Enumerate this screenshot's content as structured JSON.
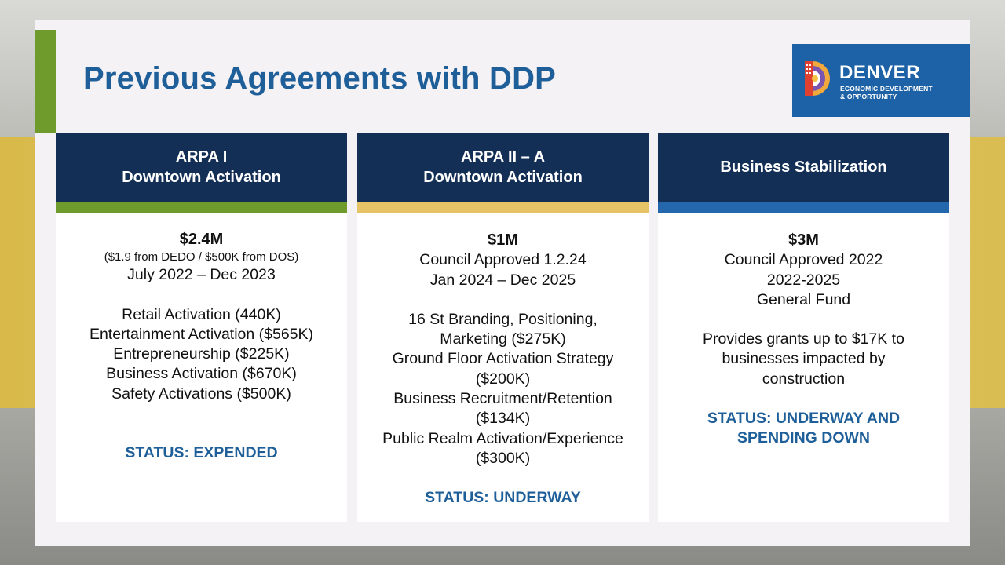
{
  "slide": {
    "title": "Previous Agreements with DDP",
    "logo": {
      "name": "DENVER",
      "sub_line1": "ECONOMIC DEVELOPMENT",
      "sub_line2": "& OPPORTUNITY"
    }
  },
  "colors": {
    "title_blue": "#1f5f99",
    "header_navy": "#132f56",
    "green": "#6f9a2c",
    "gold": "#e6c466",
    "blue": "#2467ad"
  },
  "cards": [
    {
      "header_line1": "ARPA I",
      "header_line2": "Downtown Activation",
      "amount": "$2.4M",
      "note": "($1.9 from DEDO / $500K from DOS)",
      "dates": "July 2022 – Dec 2023",
      "items": [
        "Retail Activation (440K)",
        "Entertainment Activation ($565K)",
        "Entrepreneurship ($225K)",
        "Business Activation ($670K)",
        "Safety Activations ($500K)"
      ],
      "status": "STATUS: EXPENDED"
    },
    {
      "header_line1": "ARPA II – A",
      "header_line2": "Downtown Activation",
      "amount": "$1M",
      "approval": "Council Approved 1.2.24",
      "dates": "Jan 2024 – Dec 2025",
      "items": [
        "16 St Branding, Positioning,",
        "Marketing ($275K)",
        "Ground Floor Activation Strategy",
        "($200K)",
        "Business Recruitment/Retention",
        "($134K)",
        "Public Realm Activation/Experience",
        "($300K)"
      ],
      "status": "STATUS: UNDERWAY"
    },
    {
      "header": "Business Stabilization",
      "amount": "$3M",
      "approval": "Council Approved 2022",
      "years": "2022-2025",
      "fund": "General Fund",
      "description": [
        "Provides grants up to $17K to",
        "businesses impacted by",
        "construction"
      ],
      "status_line1": "STATUS: UNDERWAY AND",
      "status_line2": "SPENDING DOWN"
    }
  ]
}
